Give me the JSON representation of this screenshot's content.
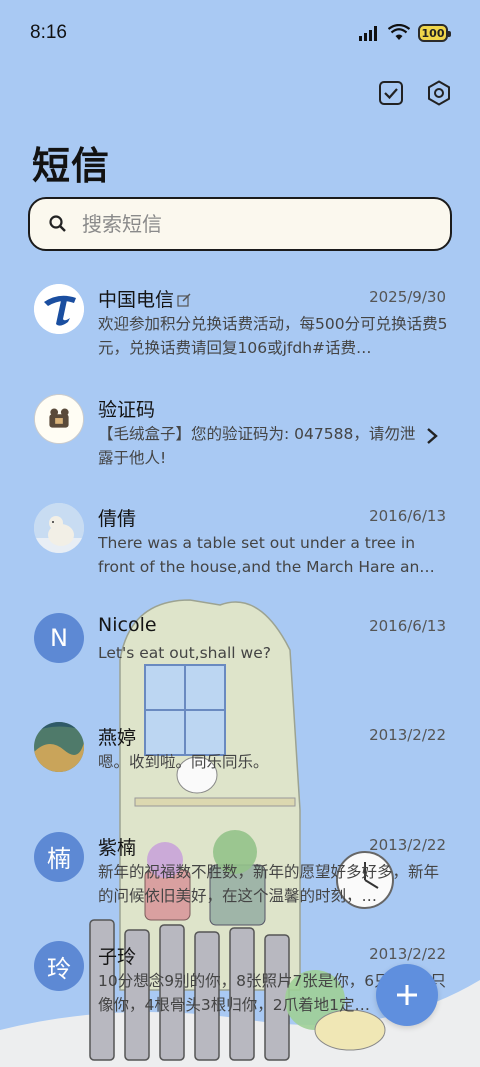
{
  "status_bar": {
    "time": "8:16",
    "battery": "100"
  },
  "header": {
    "title": "短信",
    "icons": [
      "checkbox-icon",
      "settings-gear-icon"
    ]
  },
  "search": {
    "placeholder": "搜索短信"
  },
  "conversations": [
    {
      "name": "中国电信",
      "date": "2025/9/30",
      "preview": "欢迎参加积分兑换话费活动，每500分可兑换话费5元，兑换话费请回复106或jfdh#话费…",
      "avatar": "china-telecom-logo",
      "has_edit_badge": true
    },
    {
      "name": "验证码",
      "date": "",
      "preview": "【毛绒盒子】您的验证码为: 047588，请勿泄露于他人!",
      "avatar": "plush-box-logo",
      "has_chevron": true
    },
    {
      "name": "倩倩",
      "date": "2016/6/13",
      "preview": "There was a table set out under a tree in front of the house,and the March Hare an…",
      "avatar": "polar-bear-photo"
    },
    {
      "name": "Nicole",
      "date": "2016/6/13",
      "preview": "Let's eat out,shall we?",
      "avatar_letter": "N"
    },
    {
      "name": "燕婷",
      "date": "2013/2/22",
      "preview": "嗯。收到啦。同乐同乐。",
      "avatar": "landscape-photo"
    },
    {
      "name": "紫楠",
      "date": "2013/2/22",
      "preview": "新年的祝福数不胜数，新年的愿望好多好多，新年的问候依旧美好，在这个温馨的时刻，…",
      "avatar_letter": "楠"
    },
    {
      "name": "子玲",
      "date": "2013/2/22",
      "preview": "10分想念9别的你，8张照片7张是你，6只小狗5只像你，4根骨头3根归你，2爪着地1定…",
      "avatar_letter": "玲"
    }
  ],
  "colors": {
    "background": "#a9c9f3",
    "accent": "#5f8fde",
    "avatar_letter_bg": "#5d89d4"
  }
}
